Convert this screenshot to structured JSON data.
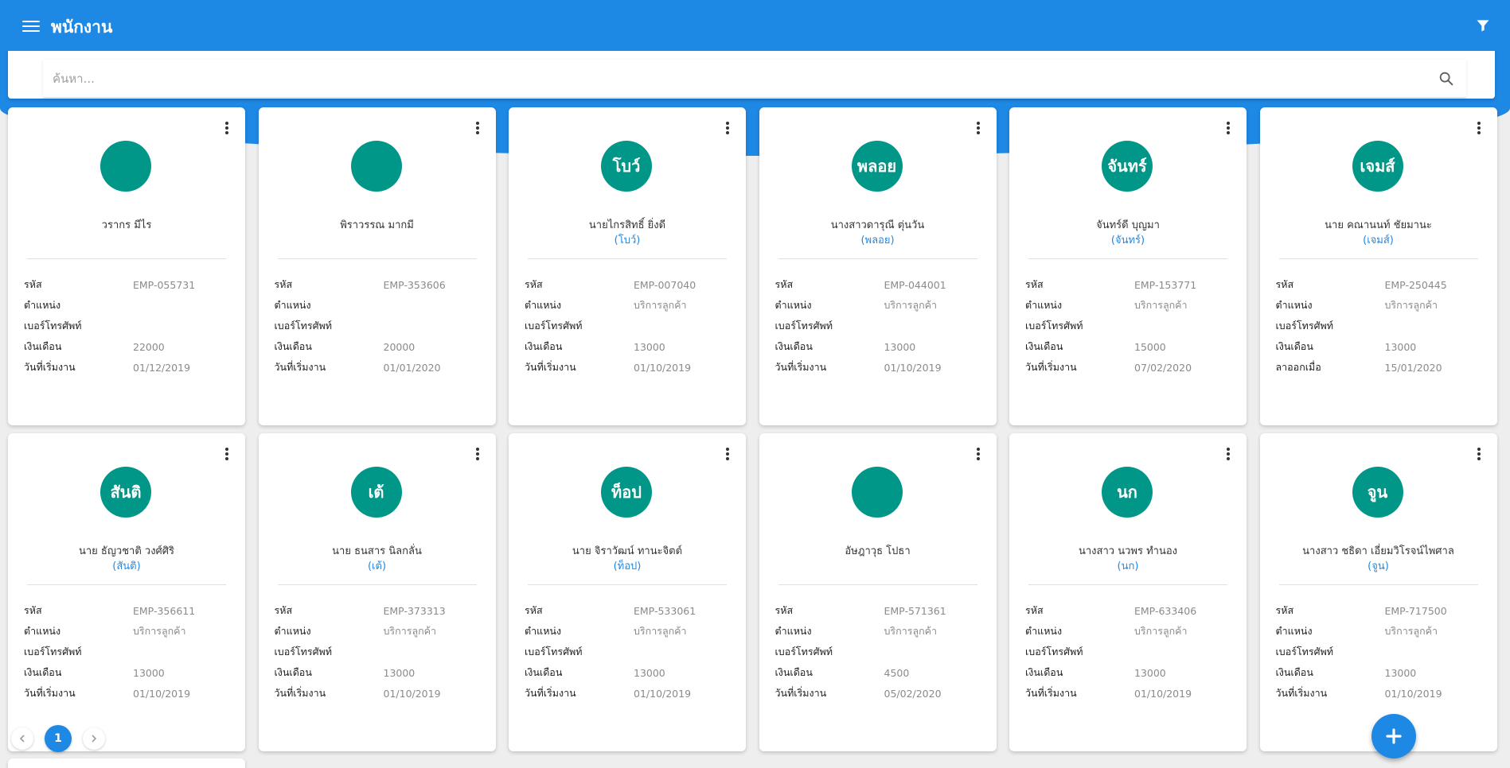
{
  "app": {
    "title": "พนักงาน"
  },
  "search": {
    "placeholder": "ค้นหา..."
  },
  "labels": {
    "code": "รหัส",
    "position": "ตำแหน่ง",
    "phone": "เบอร์โทรศัพท์",
    "salary": "เงินเดือน",
    "start_date": "วันที่เริ่มงาน",
    "left_date": "ลาออกเมื่อ"
  },
  "employees": [
    {
      "avatar": "",
      "name": "วรากร มีไร",
      "nickname": "",
      "code": "EMP-055731",
      "position": "",
      "phone": "",
      "salary": "22000",
      "date_label": "วันที่เริ่มงาน",
      "date": "01/12/2019"
    },
    {
      "avatar": "",
      "name": "พิราวรรณ มากมี",
      "nickname": "",
      "code": "EMP-353606",
      "position": "",
      "phone": "",
      "salary": "20000",
      "date_label": "วันที่เริ่มงาน",
      "date": "01/01/2020"
    },
    {
      "avatar": "โบว์",
      "name": "นายไกรสิทธิ์ ยิ่งดี",
      "nickname": "(โบว์)",
      "code": "EMP-007040",
      "position": "บริการลูกค้า",
      "phone": "",
      "salary": "13000",
      "date_label": "วันที่เริ่มงาน",
      "date": "01/10/2019"
    },
    {
      "avatar": "พลอย",
      "name": "นางสาวดารุณี ตุ่นวัน",
      "nickname": "(พลอย)",
      "code": "EMP-044001",
      "position": "บริการลูกค้า",
      "phone": "",
      "salary": "13000",
      "date_label": "วันที่เริ่มงาน",
      "date": "01/10/2019"
    },
    {
      "avatar": "จันทร์",
      "name": "จันทร์ดี บุญมา",
      "nickname": "(จันทร์)",
      "code": "EMP-153771",
      "position": "บริการลูกค้า",
      "phone": "",
      "salary": "15000",
      "date_label": "วันที่เริ่มงาน",
      "date": "07/02/2020"
    },
    {
      "avatar": "เจมส์",
      "name": "นาย คณานนท์ ชัยมานะ",
      "nickname": "(เจมส์)",
      "code": "EMP-250445",
      "position": "บริการลูกค้า",
      "phone": "",
      "salary": "13000",
      "date_label": "ลาออกเมื่อ",
      "date": "15/01/2020"
    },
    {
      "avatar": "สันติ",
      "name": "นาย ธัญวชาติ วงศ์ศิริ",
      "nickname": "(สันติ)",
      "code": "EMP-356611",
      "position": "บริการลูกค้า",
      "phone": "",
      "salary": "13000",
      "date_label": "วันที่เริ่มงาน",
      "date": "01/10/2019"
    },
    {
      "avatar": "เต้",
      "name": "นาย ธนสาร นิลกลั่น",
      "nickname": "(เต้)",
      "code": "EMP-373313",
      "position": "บริการลูกค้า",
      "phone": "",
      "salary": "13000",
      "date_label": "วันที่เริ่มงาน",
      "date": "01/10/2019"
    },
    {
      "avatar": "ท็อป",
      "name": "นาย จิราวัฒน์ ทานะจิตต์",
      "nickname": "(ท็อป)",
      "code": "EMP-533061",
      "position": "บริการลูกค้า",
      "phone": "",
      "salary": "13000",
      "date_label": "วันที่เริ่มงาน",
      "date": "01/10/2019"
    },
    {
      "avatar": "",
      "name": "อัษฎาวุธ โปธา",
      "nickname": "",
      "code": "EMP-571361",
      "position": "บริการลูกค้า",
      "phone": "",
      "salary": "4500",
      "date_label": "วันที่เริ่มงาน",
      "date": "05/02/2020"
    },
    {
      "avatar": "นก",
      "name": "นางสาว นวพร ทำนอง",
      "nickname": "(นก)",
      "code": "EMP-633406",
      "position": "บริการลูกค้า",
      "phone": "",
      "salary": "13000",
      "date_label": "วันที่เริ่มงาน",
      "date": "01/10/2019"
    },
    {
      "avatar": "จูน",
      "name": "นางสาว ชธิดา เอี่ยมวิโรจน์ไพศาล",
      "nickname": "(จูน)",
      "code": "EMP-717500",
      "position": "บริการลูกค้า",
      "phone": "",
      "salary": "13000",
      "date_label": "วันที่เริ่มงาน",
      "date": "01/10/2019"
    }
  ],
  "pagination": {
    "current": "1"
  },
  "colors": {
    "primary": "#1e88e5",
    "avatar": "#009688",
    "background": "#eeeeee"
  },
  "icons": {
    "menu": "menu-icon",
    "filter": "filter-icon",
    "search": "search-icon",
    "more": "more-vert-icon",
    "add": "plus-icon",
    "prev": "chevron-left-icon",
    "next": "chevron-right-icon"
  }
}
